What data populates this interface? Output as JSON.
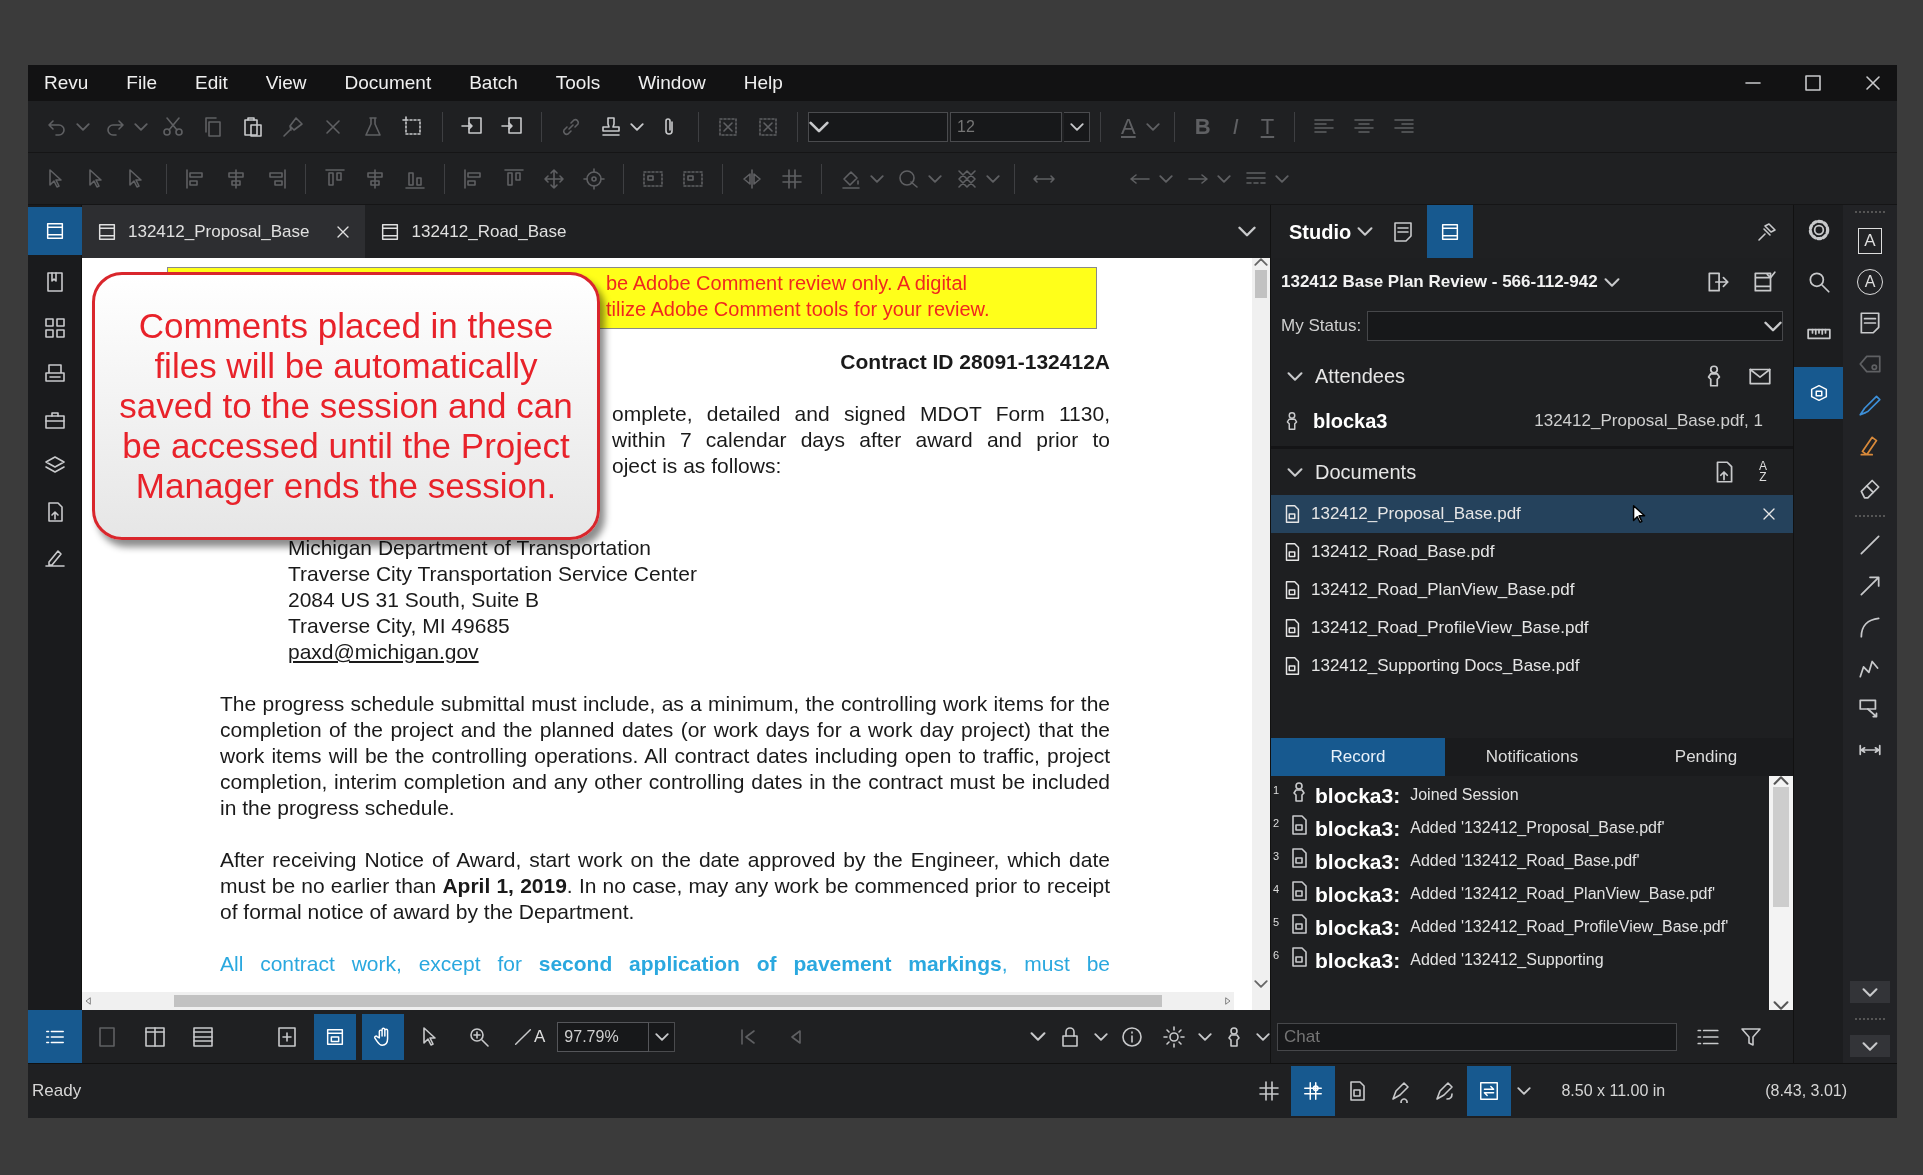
{
  "menu": [
    "Revu",
    "File",
    "Edit",
    "View",
    "Document",
    "Batch",
    "Tools",
    "Window",
    "Help"
  ],
  "toolbar": {
    "font_size_placeholder": "12",
    "letters": [
      "A",
      "B",
      "I",
      "T"
    ]
  },
  "doc_tabs": [
    {
      "label": "132412_Proposal_Base",
      "selected": true
    },
    {
      "label": "132412_Road_Base",
      "selected": false
    }
  ],
  "document": {
    "banner": [
      "be Adobe Comment review only. A digital",
      "tilize Adobe Comment tools for your review."
    ],
    "contract_id": "Contract ID 28091-132412A",
    "intro": [
      "omplete, detailed and signed MDOT Form 1130,",
      "within 7 calendar days after award and prior to",
      "oject is as follows:"
    ],
    "address": [
      "Michigan Department of Transportation",
      "Traverse City Transportation Service Center",
      "2084 US 31 South, Suite B",
      "Traverse City, MI  49685"
    ],
    "email": "paxd@michigan.gov",
    "paragraphs": [
      "The progress schedule submittal must include, as a minimum, the controlling work items for the completion of the project and the planned dates (or work days for a work day project) that the work items will be the controlling operations.  All contract dates including open to traffic, project completion, interim completion and any other controlling dates in the contract must be included in the progress schedule.",
      "After receiving Notice of Award, start work on the date approved by the Engineer, which date must be no earlier than **April 1, 2019**.  In no case, may any work be commenced prior to receipt of formal notice of award by the Department."
    ],
    "last_line": "All contract work, except for **second application of pavement markings**, must be"
  },
  "callout": "Comments placed in these files will be automatically saved to the session and can be accessed until the Project Manager ends the session.",
  "studio": {
    "title": "Studio",
    "session": "132412 Base Plan Review - 566-112-942",
    "status_label": "My Status:",
    "attendees_title": "Attendees",
    "attendees": [
      {
        "name": "blocka3",
        "detail": "132412_Proposal_Base.pdf, 1"
      }
    ],
    "documents_title": "Documents",
    "documents": [
      {
        "name": "132412_Proposal_Base.pdf",
        "selected": true
      },
      {
        "name": "132412_Road_Base.pdf",
        "selected": false
      },
      {
        "name": "132412_Road_PlanView_Base.pdf",
        "selected": false
      },
      {
        "name": "132412_Road_ProfileView_Base.pdf",
        "selected": false
      },
      {
        "name": "132412_Supporting Docs_Base.pdf",
        "selected": false
      }
    ],
    "sort_letters": [
      "A",
      "Z"
    ],
    "record_tabs": [
      {
        "label": "Record",
        "selected": true
      },
      {
        "label": "Notifications",
        "selected": false
      },
      {
        "label": "Pending",
        "selected": false
      }
    ],
    "records": [
      {
        "number": "1",
        "kind": "user",
        "user": "blocka3:",
        "action": "Joined Session"
      },
      {
        "number": "2",
        "kind": "file",
        "user": "blocka3:",
        "action": "Added '132412_Proposal_Base.pdf'"
      },
      {
        "number": "3",
        "kind": "file",
        "user": "blocka3:",
        "action": "Added '132412_Road_Base.pdf'"
      },
      {
        "number": "4",
        "kind": "file",
        "user": "blocka3:",
        "action": "Added '132412_Road_PlanView_Base.pdf'"
      },
      {
        "number": "5",
        "kind": "file",
        "user": "blocka3:",
        "action": "Added '132412_Road_ProfileView_Base.pdf'"
      },
      {
        "number": "6",
        "kind": "file",
        "user": "blocka3:",
        "action": "Added '132412_Supporting"
      }
    ],
    "chat_placeholder": "Chat"
  },
  "markup_letters": [
    "A",
    "A"
  ],
  "bottom": {
    "text_select_letter": "A",
    "zoom": "97.79%"
  },
  "status": {
    "text": "Ready",
    "page_size": "8.50 x 11.00 in",
    "coords": "(8.43, 3.01)"
  }
}
